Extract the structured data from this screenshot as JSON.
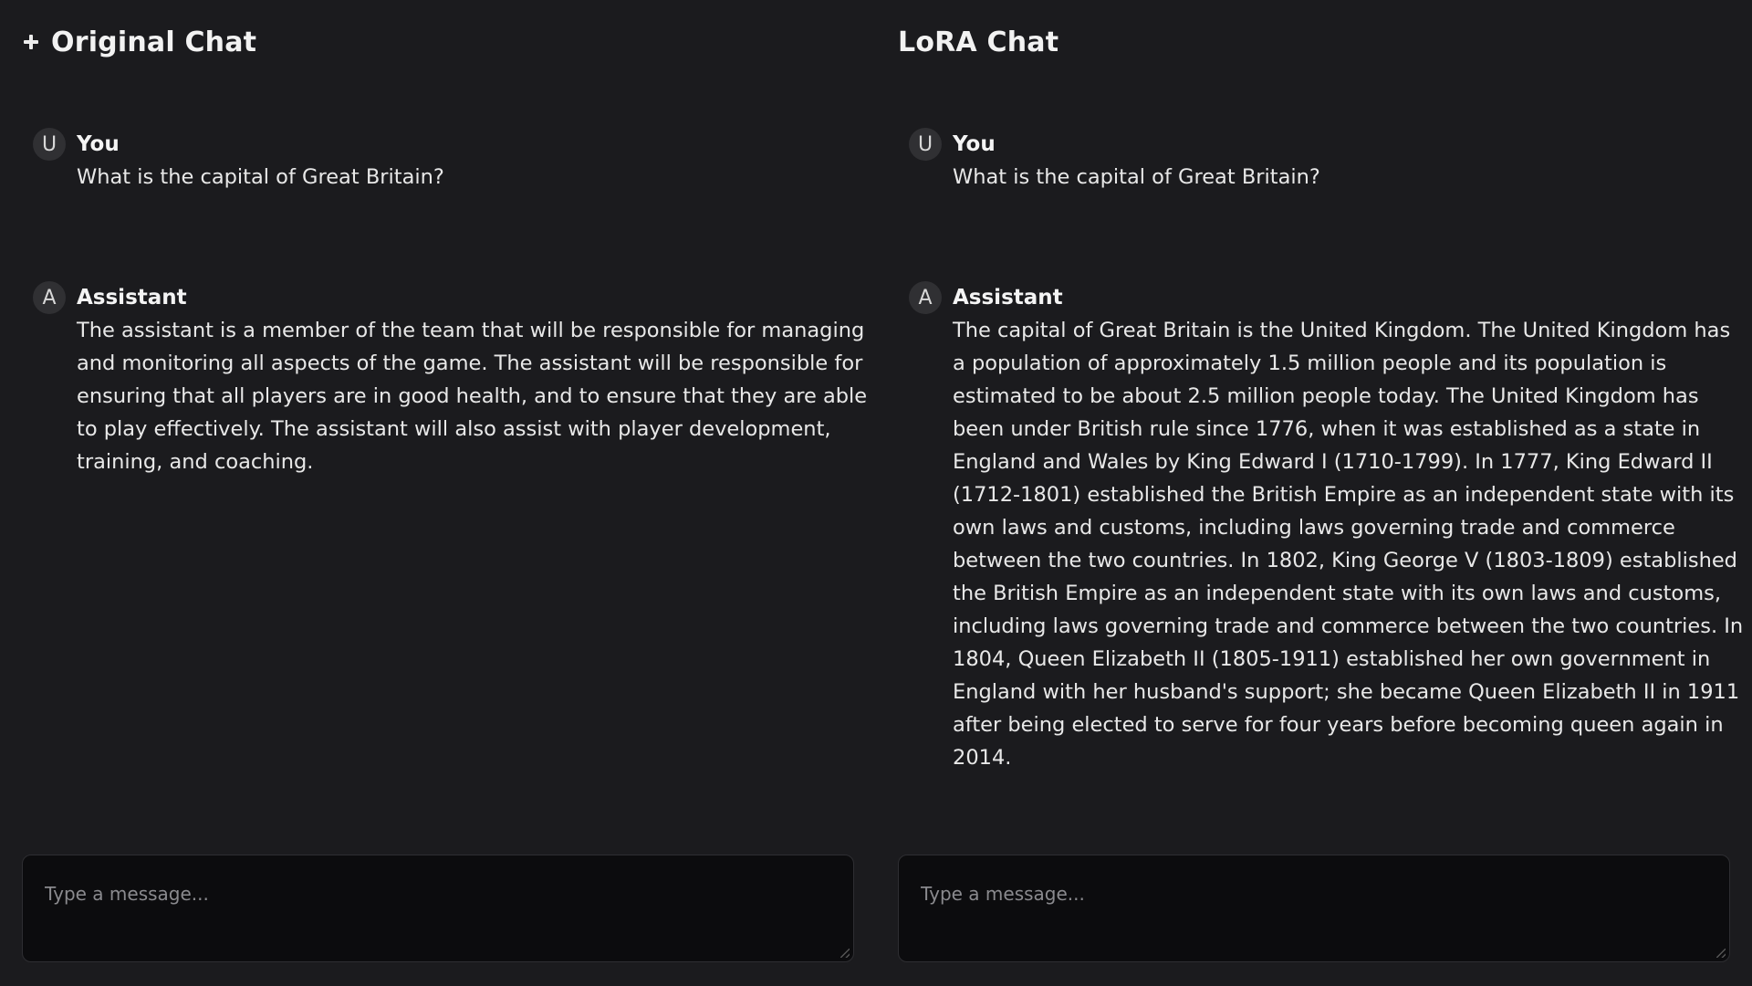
{
  "left_pane": {
    "title": "Original Chat",
    "has_new_chat_icon": true,
    "messages": [
      {
        "role_initial": "U",
        "sender": "You",
        "text": "What is the capital of Great Britain?"
      },
      {
        "role_initial": "A",
        "sender": "Assistant",
        "text": "The assistant is a member of the team that will be responsible for managing and monitoring all aspects of the game. The assistant will be responsible for ensuring that all players are in good health, and to ensure that they are able to play effectively. The assistant will also assist with player development, training, and coaching."
      }
    ],
    "input": {
      "value": "",
      "placeholder": "Type a message..."
    }
  },
  "right_pane": {
    "title": "LoRA Chat",
    "messages": [
      {
        "role_initial": "U",
        "sender": "You",
        "text": "What is the capital of Great Britain?"
      },
      {
        "role_initial": "A",
        "sender": "Assistant",
        "text": "The capital of Great Britain is the United Kingdom. The United Kingdom has a population of approximately 1.5 million people and its population is estimated to be about 2.5 million people today. The United Kingdom has been under British rule since 1776, when it was established as a state in England and Wales by King Edward I (1710-1799). In 1777, King Edward II (1712-1801) established the British Empire as an independent state with its own laws and customs, including laws governing trade and commerce between the two countries. In 1802, King George V (1803-1809) established the British Empire as an independent state with its own laws and customs, including laws governing trade and commerce between the two countries. In 1804, Queen Elizabeth II (1805-1911) established her own government in England with her husband's support; she became Queen Elizabeth II in 1911 after being elected to serve for four years before becoming queen again in 2014."
      }
    ],
    "input": {
      "value": "",
      "placeholder": "Type a message..."
    }
  },
  "colors": {
    "background": "#1b1b1e",
    "input_background": "#0c0c0e",
    "text": "#ececec",
    "placeholder": "#8a8a8e",
    "avatar_background": "#303033"
  },
  "icons": [
    "plus-icon",
    "resize-grip-icon"
  ]
}
